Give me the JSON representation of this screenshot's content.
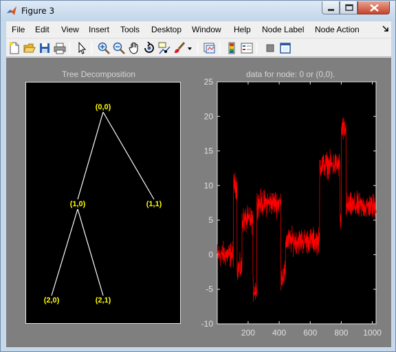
{
  "window": {
    "title": "Figure 3"
  },
  "menu": [
    "File",
    "Edit",
    "View",
    "Insert",
    "Tools",
    "Desktop",
    "Window",
    "Help",
    "Node Label",
    "Node Action"
  ],
  "toolbar": [
    {
      "name": "new-figure-icon"
    },
    {
      "name": "open-file-icon"
    },
    {
      "name": "save-icon"
    },
    {
      "name": "print-icon"
    },
    {
      "name": "edit-plot-arrow-icon"
    },
    {
      "name": "zoom-in-icon"
    },
    {
      "name": "zoom-out-icon"
    },
    {
      "name": "pan-hand-icon"
    },
    {
      "name": "rotate-3d-icon"
    },
    {
      "name": "data-cursor-icon"
    },
    {
      "name": "brush-icon"
    },
    {
      "name": "brush-dropdown-icon"
    },
    {
      "name": "link-plot-icon"
    },
    {
      "name": "colorbar-icon"
    },
    {
      "name": "legend-icon"
    },
    {
      "name": "hide-plot-tools-icon"
    },
    {
      "name": "show-plot-tools-icon"
    }
  ],
  "tree": {
    "title": "Tree Decomposition",
    "nodes": [
      {
        "label": "(0,0)"
      },
      {
        "label": "(1,0)"
      },
      {
        "label": "(1,1)"
      },
      {
        "label": "(2,0)"
      },
      {
        "label": "(2,1)"
      }
    ],
    "edges": [
      [
        "(0,0)",
        "(1,0)"
      ],
      [
        "(0,0)",
        "(1,1)"
      ],
      [
        "(1,0)",
        "(2,0)"
      ],
      [
        "(1,0)",
        "(2,1)"
      ]
    ],
    "line_color": "#ffffff",
    "label_color": "#ffff00"
  },
  "chart_data": {
    "type": "line",
    "title": "data for node: 0 or (0,0).",
    "xlabel": "",
    "ylabel": "",
    "xlim": [
      1,
      1024
    ],
    "ylim": [
      -10,
      25
    ],
    "xticks": [
      200,
      400,
      600,
      800,
      1000
    ],
    "yticks": [
      -10,
      -5,
      0,
      5,
      10,
      15,
      20,
      25
    ],
    "yaxis_location": "left",
    "grid": false,
    "series": [
      {
        "color": "#ff0000",
        "noise_amplitude": 1.5,
        "segments": [
          {
            "x": [
              1,
              105
            ],
            "y": 0
          },
          {
            "x": [
              106,
              128
            ],
            "y": 10
          },
          {
            "x": [
              129,
              160
            ],
            "y": -2
          },
          {
            "x": [
              161,
              230
            ],
            "y": 5
          },
          {
            "x": [
              231,
              255
            ],
            "y": -5
          },
          {
            "x": [
              256,
              410
            ],
            "y": 7.5
          },
          {
            "x": [
              411,
              440
            ],
            "y": -3
          },
          {
            "x": [
              441,
              660
            ],
            "y": 2
          },
          {
            "x": [
              661,
              790
            ],
            "y": 13
          },
          {
            "x": [
              791,
              800
            ],
            "y": 5
          },
          {
            "x": [
              801,
              830
            ],
            "y": 18
          },
          {
            "x": [
              831,
              1024
            ],
            "y": 7
          }
        ]
      }
    ]
  }
}
